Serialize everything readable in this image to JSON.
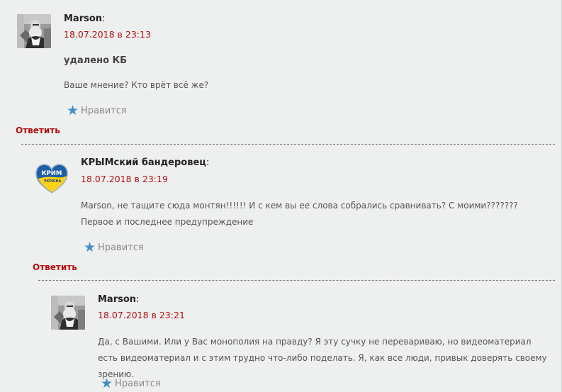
{
  "comments": [
    {
      "author": "Marson",
      "date": "18.07.2018 в 23:13",
      "paragraphs": [
        "удалено КБ",
        "Ваше мнение? Кто врёт всё же?"
      ],
      "like_label": "Нравится",
      "reply_label": "Ответить",
      "avatar_icon": "bearded-man-photo-avatar"
    },
    {
      "author": "КРЫМский бандеровец",
      "date": "18.07.2018 в 23:19",
      "paragraphs": [
        "Marson, не тащите сюда монтян!!!!!! И с кем вы ее слова собрались сравнивать? С моими??????? Первое и последнее предупреждение"
      ],
      "like_label": "Нравится",
      "reply_label": "Ответить",
      "avatar_icon": "crimea-ukraine-heart-avatar",
      "avatar_text_top": "КРИМ",
      "avatar_text_bottom": "УКРАЇНА"
    },
    {
      "author": "Marson",
      "date": "18.07.2018 в 23:21",
      "paragraphs": [
        "Да, с Вашими. Или у Вас монополия на правду? Я эту сучку не перевариваю, но видеоматериал есть видеоматериал и с этим трудно что-либо поделать. Я, как все люди, привык доверять своему зрению."
      ],
      "like_label": "Нравится",
      "avatar_icon": "bearded-man-photo-avatar"
    }
  ],
  "colors": {
    "background": "#eeefef",
    "date": "#b40f0f",
    "reply": "#b40f0f",
    "star": "#3f8fc5"
  }
}
